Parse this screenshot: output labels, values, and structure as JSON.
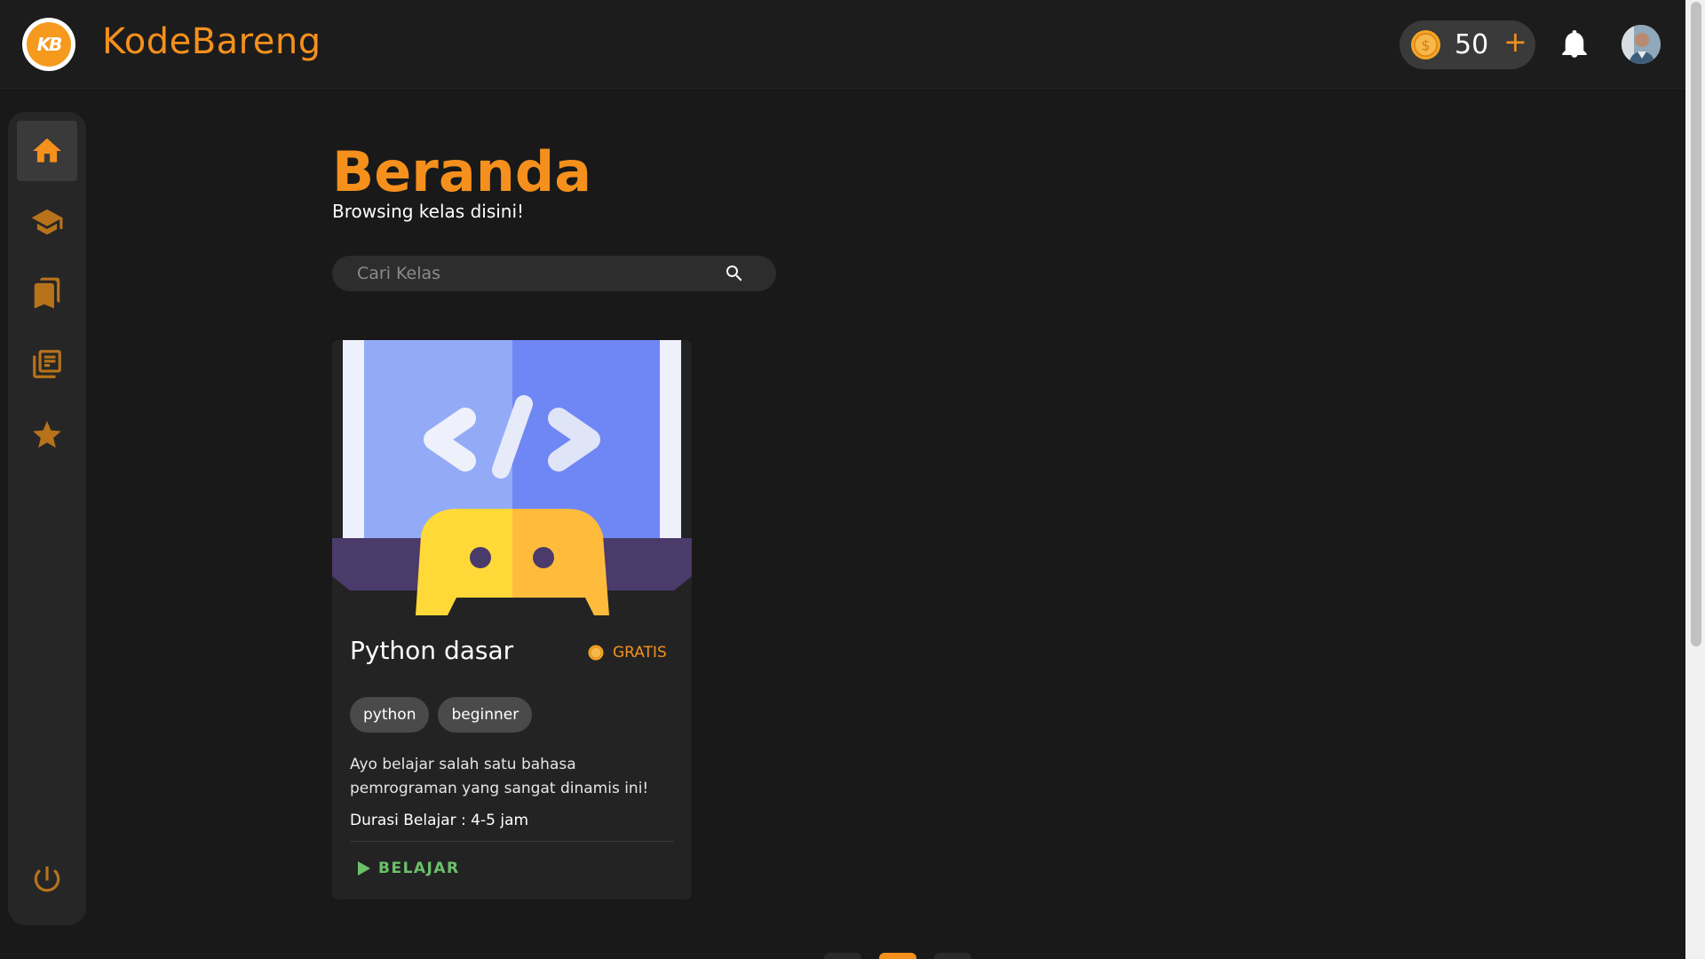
{
  "header": {
    "logo_text": "KB",
    "brand": "KodeBareng",
    "coins": "50",
    "coin_add": "+"
  },
  "sidebar": {
    "items": [
      {
        "name": "home",
        "active": true
      },
      {
        "name": "courses",
        "active": false
      },
      {
        "name": "bookmarks",
        "active": false
      },
      {
        "name": "articles",
        "active": false
      },
      {
        "name": "favorites",
        "active": false
      }
    ]
  },
  "main": {
    "title": "Beranda",
    "subtitle": "Browsing kelas disini!",
    "search_placeholder": "Cari Kelas"
  },
  "course": {
    "title": "Python dasar",
    "price": "GRATIS",
    "tags": [
      "python",
      "beginner"
    ],
    "description": "Ayo belajar salah satu bahasa pemrograman yang sangat dinamis ini!",
    "duration": "Durasi Belajar : 4-5 jam",
    "cta": "BELAJAR"
  },
  "colors": {
    "accent": "#f5901d",
    "background": "#191919",
    "success": "#6bc16b"
  }
}
